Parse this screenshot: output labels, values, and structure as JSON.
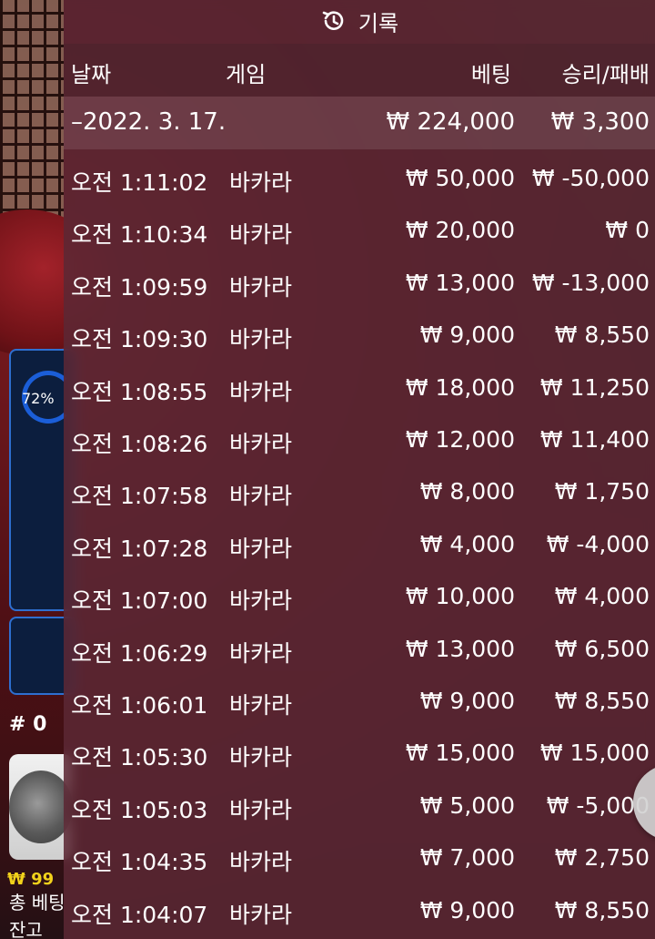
{
  "overlay": {
    "title": "기록",
    "headers": {
      "date": "날짜",
      "game": "게임",
      "bet": "베팅",
      "winloss": "승리/패배"
    },
    "summary": {
      "date": "–2022. 3. 17.",
      "bet": "₩ 224,000",
      "winloss": "₩ 3,300"
    },
    "rows": [
      {
        "time": "오전 1:11:02",
        "game": "바카라",
        "bet": "₩ 50,000",
        "winloss": "₩ -50,000"
      },
      {
        "time": "오전 1:10:34",
        "game": "바카라",
        "bet": "₩ 20,000",
        "winloss": "₩ 0"
      },
      {
        "time": "오전 1:09:59",
        "game": "바카라",
        "bet": "₩ 13,000",
        "winloss": "₩ -13,000"
      },
      {
        "time": "오전 1:09:30",
        "game": "바카라",
        "bet": "₩ 9,000",
        "winloss": "₩ 8,550"
      },
      {
        "time": "오전 1:08:55",
        "game": "바카라",
        "bet": "₩ 18,000",
        "winloss": "₩ 11,250"
      },
      {
        "time": "오전 1:08:26",
        "game": "바카라",
        "bet": "₩ 12,000",
        "winloss": "₩ 11,400"
      },
      {
        "time": "오전 1:07:58",
        "game": "바카라",
        "bet": "₩ 8,000",
        "winloss": "₩ 1,750"
      },
      {
        "time": "오전 1:07:28",
        "game": "바카라",
        "bet": "₩ 4,000",
        "winloss": "₩ -4,000"
      },
      {
        "time": "오전 1:07:00",
        "game": "바카라",
        "bet": "₩ 10,000",
        "winloss": "₩ 4,000"
      },
      {
        "time": "오전 1:06:29",
        "game": "바카라",
        "bet": "₩ 13,000",
        "winloss": "₩ 6,500"
      },
      {
        "time": "오전 1:06:01",
        "game": "바카라",
        "bet": "₩ 9,000",
        "winloss": "₩ 8,550"
      },
      {
        "time": "오전 1:05:30",
        "game": "바카라",
        "bet": "₩ 15,000",
        "winloss": "₩ 15,000"
      },
      {
        "time": "오전 1:05:03",
        "game": "바카라",
        "bet": "₩ 5,000",
        "winloss": "₩ -5,000"
      },
      {
        "time": "오전 1:04:35",
        "game": "바카라",
        "bet": "₩ 7,000",
        "winloss": "₩ 2,750"
      },
      {
        "time": "오전 1:04:07",
        "game": "바카라",
        "bet": "₩ 9,000",
        "winloss": "₩ 8,550"
      }
    ]
  },
  "background": {
    "stat_percent": "72%",
    "round_label": "# 0",
    "balance_yellow": "₩ 99",
    "total_bet_label": "총 베팅",
    "balance_label": "잔고"
  },
  "icons": {
    "history": "history-icon",
    "close": "close-icon"
  }
}
